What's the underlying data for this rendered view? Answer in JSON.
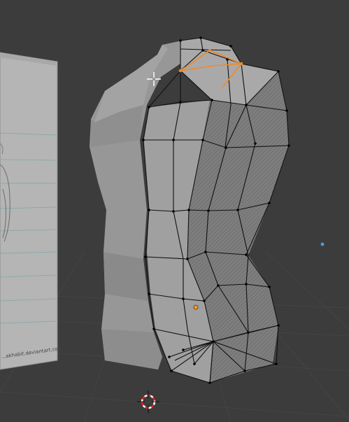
{
  "viewport": {
    "mode": "Edit Mode",
    "background_color": "#3c3c3c",
    "grid_color": "#454545",
    "mesh_face_color": "#9a9a9a",
    "mesh_edge_color": "#111111",
    "selection_color": "#f08a24",
    "light_color": "#4aa0e0"
  },
  "reference_image": {
    "watermark": "...akhabit.deviantart.com"
  },
  "objects": {
    "mesh": "torso-mesh",
    "reference": "reference-image-plane",
    "cursor": "3d-cursor",
    "light": "light-point"
  }
}
